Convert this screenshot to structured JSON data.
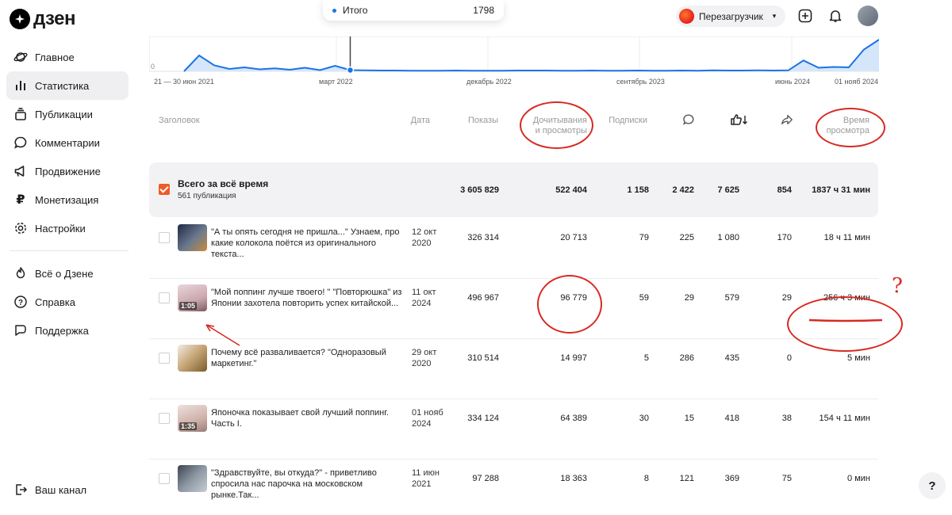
{
  "app": {
    "logo_text": "дзен"
  },
  "sidebar": {
    "items": [
      {
        "label": "Главное",
        "icon": "planet-icon"
      },
      {
        "label": "Статистика",
        "icon": "bar-chart-icon",
        "active": true
      },
      {
        "label": "Публикации",
        "icon": "stack-icon"
      },
      {
        "label": "Комментарии",
        "icon": "comment-icon"
      },
      {
        "label": "Продвижение",
        "icon": "megaphone-icon"
      },
      {
        "label": "Монетизация",
        "icon": "ruble-icon"
      },
      {
        "label": "Настройки",
        "icon": "gear-icon"
      }
    ],
    "secondary": [
      {
        "label": "Всё о Дзене",
        "icon": "flame-icon"
      },
      {
        "label": "Справка",
        "icon": "question-icon"
      },
      {
        "label": "Поддержка",
        "icon": "chat-icon"
      }
    ],
    "channel_link": {
      "label": "Ваш канал",
      "icon": "exit-icon"
    }
  },
  "header": {
    "channel_name": "Перезагрузчик"
  },
  "tooltip": {
    "label": "Итого",
    "value": "1798"
  },
  "chart_data": {
    "type": "area",
    "y_min_label": "0",
    "x_tick_labels": [
      "21 — 30 июн 2021",
      "март 2022",
      "декабрь 2022",
      "сентябрь 2023",
      "июнь 2024",
      "01 нояб 2024"
    ],
    "values": [
      0,
      80,
      30,
      12,
      20,
      10,
      15,
      8,
      18,
      6,
      28,
      6,
      5,
      4,
      4,
      3,
      3,
      3,
      4,
      3,
      3,
      3,
      4,
      4,
      4,
      3,
      3,
      4,
      3,
      3,
      4,
      3,
      3,
      4,
      3,
      5,
      4,
      4,
      5,
      4,
      5,
      55,
      18,
      22,
      20,
      110,
      160
    ],
    "highlight_index": 11
  },
  "table": {
    "headers": {
      "title": "Заголовок",
      "date": "Дата",
      "impressions": "Показы",
      "reads_1": "Дочитывания",
      "reads_2": "и просмотры",
      "subs": "Подписки",
      "time_1": "Время",
      "time_2": "просмотра"
    },
    "total": {
      "title": "Всего за всё время",
      "subtitle": "561 публикация",
      "impressions": "3 605 829",
      "reads": "522 404",
      "subs": "1 158",
      "comments": "2 422",
      "likes": "7 625",
      "shares": "854",
      "time": "1837 ч 31 мин"
    },
    "rows": [
      {
        "title": "\"А ты опять сегодня не пришла...\" Узнаем, про какие колокола поётся из оригинального текста...",
        "date_1": "12 окт",
        "date_2": "2020",
        "impressions": "326 314",
        "reads": "20 713",
        "subs": "79",
        "comments": "225",
        "likes": "1 080",
        "shares": "170",
        "time": "18 ч 11 мин",
        "duration": ""
      },
      {
        "title": "\"Мой поппинг лучше твоего! \" \"Повторюшка\" из Японии захотела повторить успех китайской...",
        "date_1": "11 окт",
        "date_2": "2024",
        "impressions": "496 967",
        "reads": "96 779",
        "subs": "59",
        "comments": "29",
        "likes": "579",
        "shares": "29",
        "time": "256 ч 3 мин",
        "duration": "1:05"
      },
      {
        "title": "Почему всё разваливается? \"Одноразовый маркетинг.\"",
        "date_1": "29 окт",
        "date_2": "2020",
        "impressions": "310 514",
        "reads": "14 997",
        "subs": "5",
        "comments": "286",
        "likes": "435",
        "shares": "0",
        "time": "5 мин",
        "duration": ""
      },
      {
        "title": "Японочка показывает свой лучший поппинг. Часть I.",
        "date_1": "01 нояб",
        "date_2": "2024",
        "impressions": "334 124",
        "reads": "64 389",
        "subs": "30",
        "comments": "15",
        "likes": "418",
        "shares": "38",
        "time": "154 ч 11 мин",
        "duration": "1:35"
      },
      {
        "title": "\"Здравствуйте, вы откуда?\" - приветливо спросила нас парочка на московском рынке.Так...",
        "date_1": "11 июн",
        "date_2": "2021",
        "impressions": "97 288",
        "reads": "18 363",
        "subs": "8",
        "comments": "121",
        "likes": "369",
        "shares": "75",
        "time": "0 мин",
        "duration": ""
      }
    ]
  },
  "annotations": {
    "question_mark": "?"
  },
  "help_button": "?"
}
